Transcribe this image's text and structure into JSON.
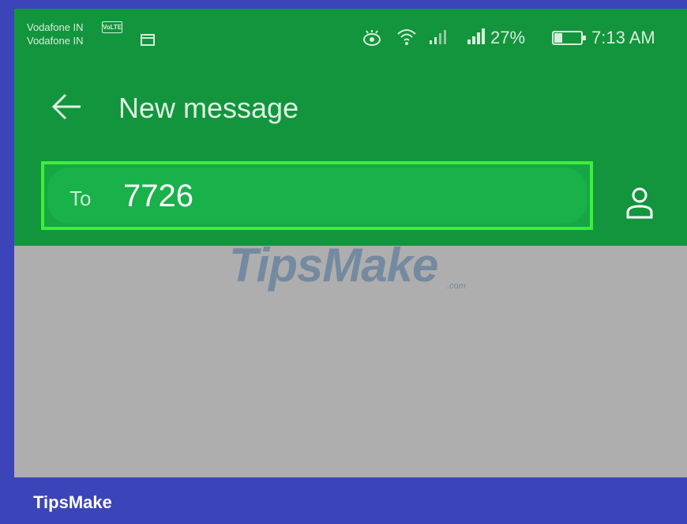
{
  "status_bar": {
    "carrier_1": "Vodafone IN",
    "carrier_2": "Vodafone IN",
    "volte_badge": "VoLTE",
    "battery_percent": "27%",
    "time": "7:13 AM",
    "icons": [
      "notification-icon",
      "eye-comfort-icon",
      "wifi-icon",
      "signal-icon",
      "battery-icon"
    ]
  },
  "toolbar": {
    "back_icon": "arrow-left",
    "title": "New message"
  },
  "recipient": {
    "label": "To",
    "value": "7726",
    "contact_icon": "person-outline"
  },
  "watermark": {
    "text": "TipsMake",
    "suffix": ".com"
  },
  "footer": {
    "brand": "TipsMake"
  },
  "colors": {
    "header_green": "#13953d",
    "highlight_border": "#3cf03a",
    "body_gray": "#aeaeae",
    "frame_blue": "#3b44b8"
  }
}
